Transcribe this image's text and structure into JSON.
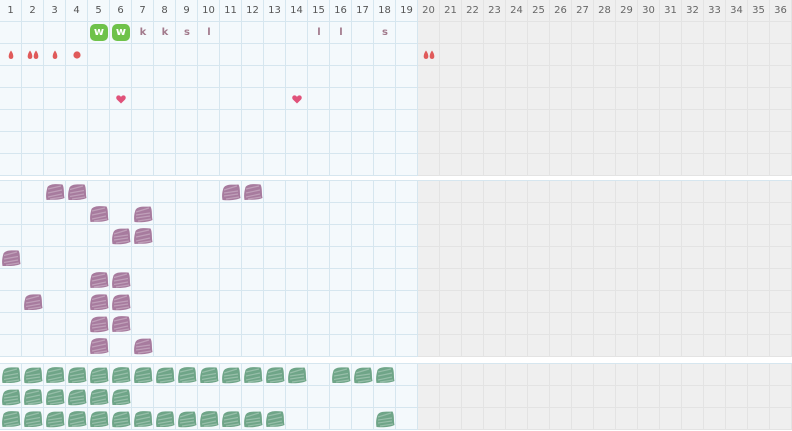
{
  "days": [
    "1",
    "2",
    "3",
    "4",
    "5",
    "6",
    "7",
    "8",
    "9",
    "10",
    "11",
    "12",
    "13",
    "14",
    "15",
    "16",
    "17",
    "18",
    "19",
    "20",
    "21",
    "22",
    "23",
    "24",
    "25",
    "26",
    "27",
    "28",
    "29",
    "30",
    "31",
    "32",
    "33",
    "34",
    "35",
    "36"
  ],
  "active_days": 19,
  "colors": {
    "grid_line": "#d6e6ef",
    "active_bg": "#f4f9fc",
    "inactive_bg": "#efefef",
    "w_badge": "#6fc24a",
    "letter": "#a27a8c",
    "drop": "#e05a5a",
    "heart": "#e0527a",
    "mauve_blob": "#a77b9e",
    "green_blob": "#6fa588"
  },
  "row1_marks": [
    {
      "day": 5,
      "kind": "badge",
      "text": "w"
    },
    {
      "day": 6,
      "kind": "badge",
      "text": "w"
    },
    {
      "day": 7,
      "kind": "letter",
      "text": "k"
    },
    {
      "day": 8,
      "kind": "letter",
      "text": "k"
    },
    {
      "day": 9,
      "kind": "letter",
      "text": "s"
    },
    {
      "day": 10,
      "kind": "letter",
      "text": "l"
    },
    {
      "day": 15,
      "kind": "letter",
      "text": "l"
    },
    {
      "day": 16,
      "kind": "letter",
      "text": "l"
    },
    {
      "day": 18,
      "kind": "letter",
      "text": "s"
    }
  ],
  "row2_drops": [
    {
      "day": 1,
      "count": 1,
      "icon": "drop-icon"
    },
    {
      "day": 2,
      "count": 2,
      "icon": "drop-icon"
    },
    {
      "day": 3,
      "count": 1,
      "icon": "drop-icon"
    },
    {
      "day": 4,
      "count": 1,
      "icon": "dot-icon"
    },
    {
      "day": 20,
      "count": 2,
      "icon": "drop-icon"
    }
  ],
  "row4_hearts": [
    {
      "day": 6,
      "icon": "heart-icon"
    },
    {
      "day": 14,
      "icon": "heart-icon"
    }
  ],
  "section2_blobs": [
    [
      3,
      4,
      11,
      12
    ],
    [
      5,
      7
    ],
    [
      6,
      7
    ],
    [
      1
    ],
    [
      5,
      6
    ],
    [
      2,
      5,
      6
    ],
    [
      5,
      6
    ],
    [
      5,
      7
    ]
  ],
  "section3_blobs": [
    [
      1,
      2,
      3,
      4,
      5,
      6,
      7,
      8,
      9,
      10,
      11,
      12,
      13,
      14,
      16,
      17,
      18
    ],
    [
      1,
      2,
      3,
      4,
      5,
      6
    ],
    [
      1,
      2,
      3,
      4,
      5,
      6,
      7,
      8,
      9,
      10,
      11,
      12,
      13,
      18
    ]
  ]
}
